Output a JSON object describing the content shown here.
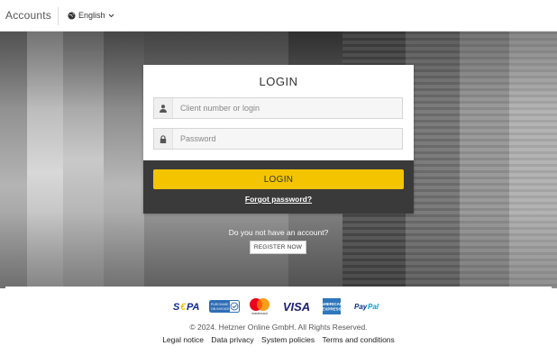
{
  "header": {
    "brand": "Accounts",
    "language": {
      "label": "English",
      "icon": "globe-icon",
      "chevron": "chevron-down-icon"
    }
  },
  "login": {
    "title": "LOGIN",
    "username": {
      "placeholder": "Client number or login",
      "value": "",
      "icon": "user-icon"
    },
    "password": {
      "placeholder": "Password",
      "value": "",
      "icon": "lock-icon"
    },
    "submit_label": "LOGIN",
    "forgot_label": "Forgot password?"
  },
  "signup": {
    "prompt": "Do you not have an account?",
    "register_label": "REGISTER NOW"
  },
  "footer": {
    "payments": [
      {
        "name": "SEPA",
        "label": "SEPA"
      },
      {
        "name": "Purchase on Invoice",
        "label": "PURCHASE ON INVOICE"
      },
      {
        "name": "Mastercard",
        "label": "mastercard"
      },
      {
        "name": "Visa",
        "label": "VISA"
      },
      {
        "name": "American Express",
        "label": "AMERICAN EXPRESS"
      },
      {
        "name": "PayPal",
        "label": "PayPal"
      }
    ],
    "copyright": "© 2024. Hetzner Online GmbH. All Rights Reserved.",
    "links": [
      "Legal notice",
      "Data privacy",
      "System policies",
      "Terms and conditions"
    ]
  },
  "colors": {
    "accent": "#f5c400",
    "card_dark": "#3a3a3a",
    "mastercard_red": "#eb001b",
    "mastercard_yellow": "#f79e1b",
    "visa_blue": "#1a1f71",
    "amex_blue": "#2e77bc",
    "paypal_blue": "#003087",
    "sepa_blue": "#10298e"
  }
}
